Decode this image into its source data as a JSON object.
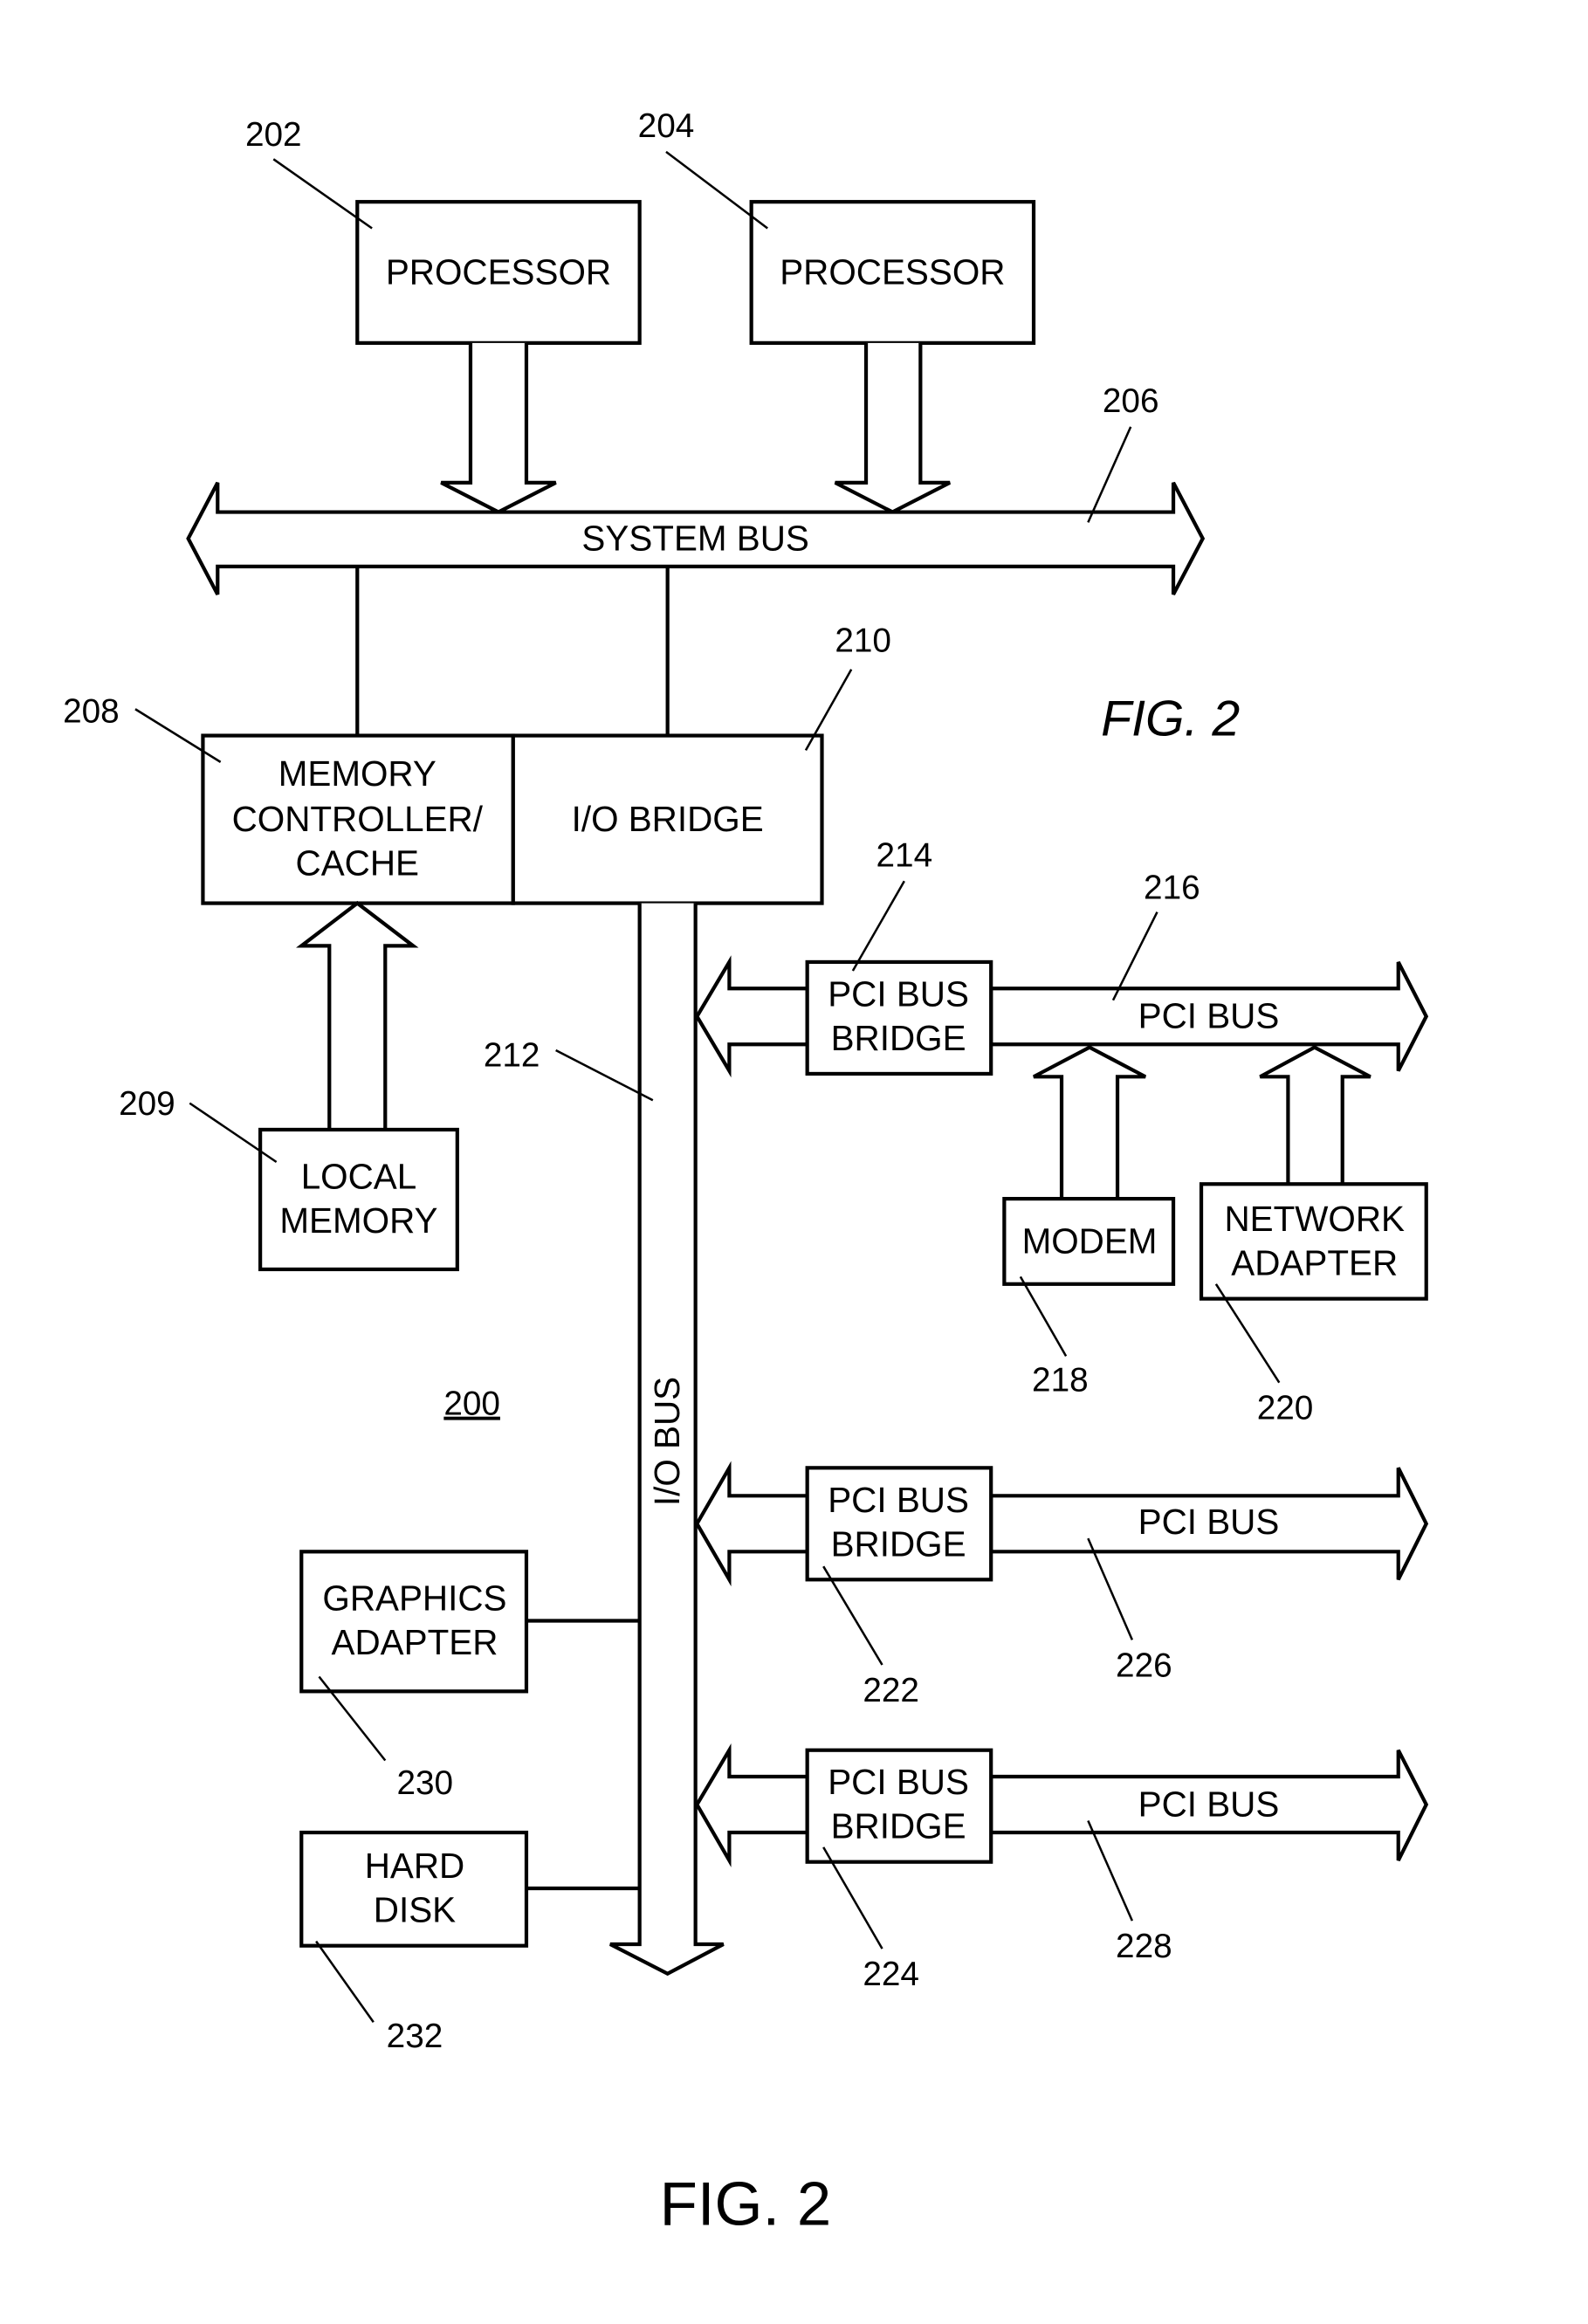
{
  "figure": {
    "caption_top": "FIG. 2",
    "caption_bottom": "FIG. 2",
    "system_ref": "200"
  },
  "boxes": {
    "proc1": {
      "label": "PROCESSOR",
      "ref": "202"
    },
    "proc2": {
      "label": "PROCESSOR",
      "ref": "204"
    },
    "memctl": {
      "lines": [
        "MEMORY",
        "CONTROLLER/",
        "CACHE"
      ],
      "ref": "208"
    },
    "iobridge": {
      "label": "I/O BRIDGE",
      "ref": "210"
    },
    "localmem": {
      "lines": [
        "LOCAL",
        "MEMORY"
      ],
      "ref": "209"
    },
    "pci1": {
      "lines": [
        "PCI BUS",
        "BRIDGE"
      ],
      "ref": "214"
    },
    "pci2": {
      "lines": [
        "PCI BUS",
        "BRIDGE"
      ],
      "ref": "222"
    },
    "pci3": {
      "lines": [
        "PCI BUS",
        "BRIDGE"
      ],
      "ref": "224"
    },
    "modem": {
      "label": "MODEM",
      "ref": "218"
    },
    "netadapter": {
      "lines": [
        "NETWORK",
        "ADAPTER"
      ],
      "ref": "220"
    },
    "graphics": {
      "lines": [
        "GRAPHICS",
        "ADAPTER"
      ],
      "ref": "230"
    },
    "harddisk": {
      "lines": [
        "HARD",
        "DISK"
      ],
      "ref": "232"
    }
  },
  "buses": {
    "system": {
      "label": "SYSTEM BUS",
      "ref": "206"
    },
    "io": {
      "label": "I/O BUS",
      "ref": "212"
    },
    "pci1": {
      "label": "PCI BUS",
      "ref": "216"
    },
    "pci2": {
      "label": "PCI BUS",
      "ref": "226"
    },
    "pci3": {
      "label": "PCI BUS",
      "ref": "228"
    }
  }
}
